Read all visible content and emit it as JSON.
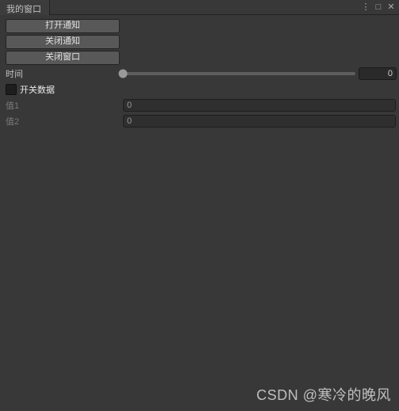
{
  "window": {
    "title": "我的窗口"
  },
  "buttons": {
    "open_notify": "打开通知",
    "close_notify": "关闭通知",
    "close_window": "关闭窗口"
  },
  "slider": {
    "label": "时间",
    "value": "0"
  },
  "toggle": {
    "label": "开关数据"
  },
  "fields": {
    "val1_label": "值1",
    "val1_value": "0",
    "val2_label": "值2",
    "val2_value": "0"
  },
  "watermark": "CSDN @寒冷的晚风"
}
